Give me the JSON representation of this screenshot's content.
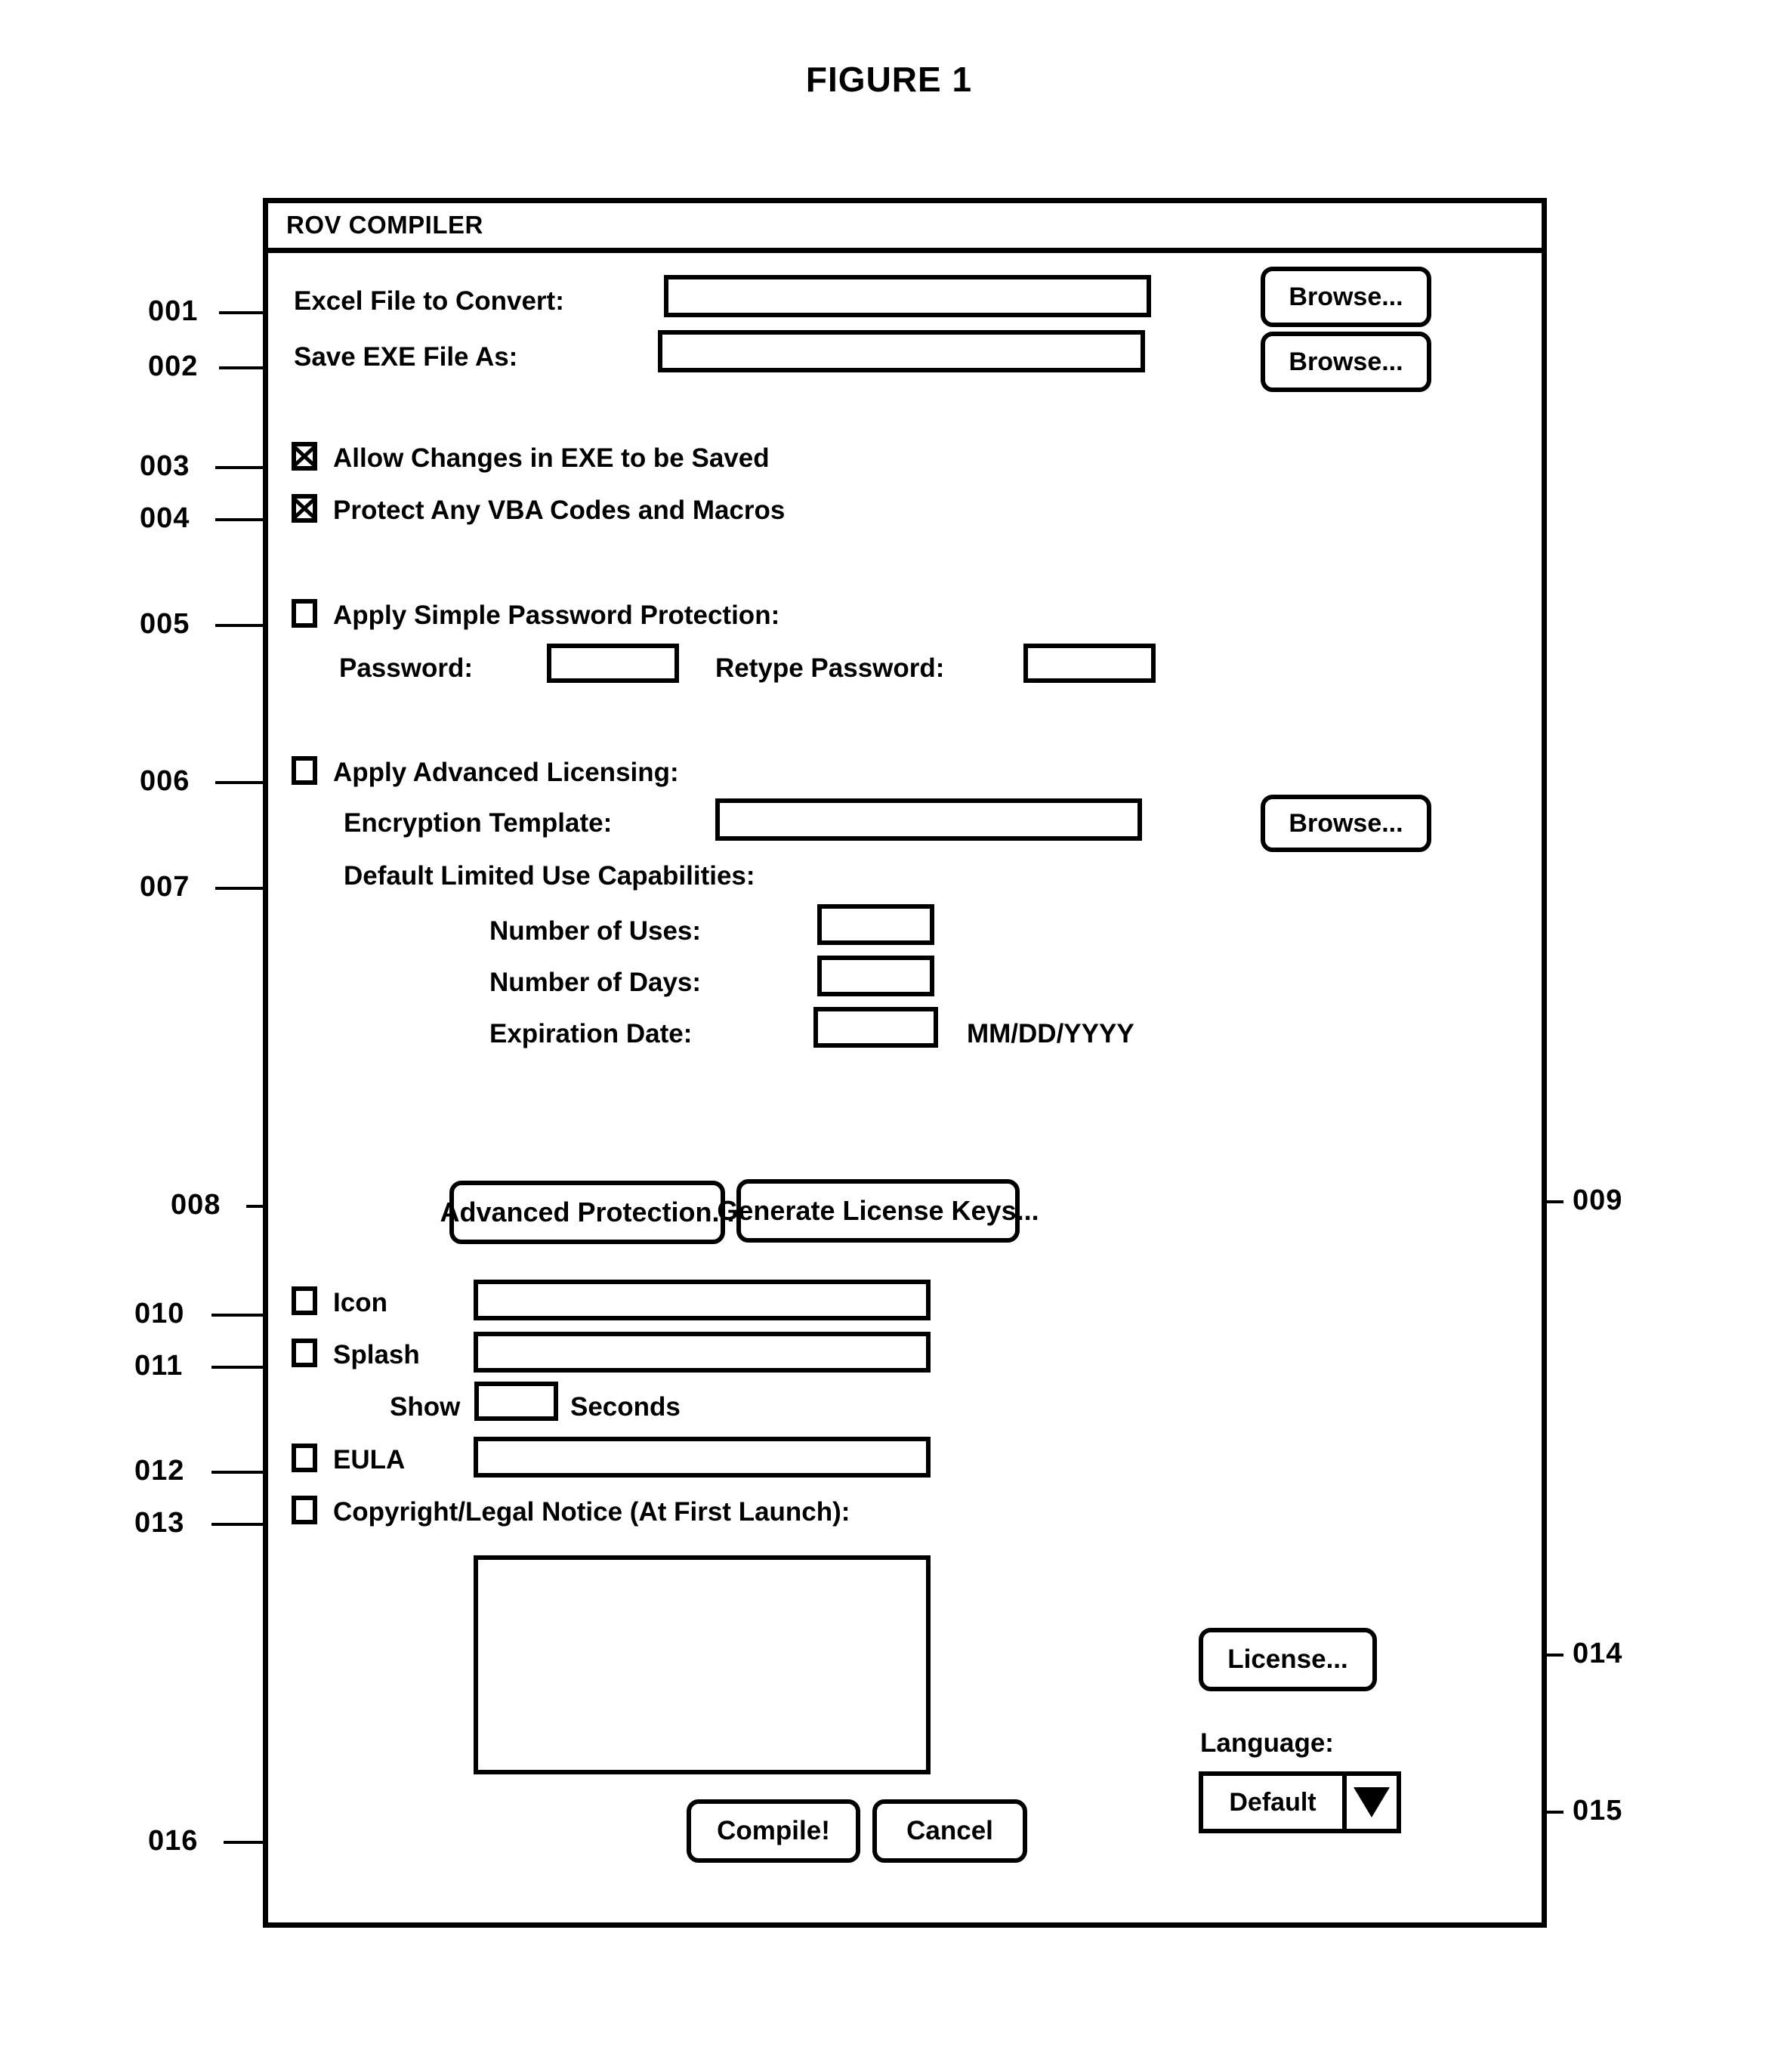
{
  "figure": {
    "title": "FIGURE 1"
  },
  "window": {
    "title": "ROV COMPILER"
  },
  "fields": {
    "excel_file_label": "Excel File to Convert:",
    "excel_file_value": "",
    "save_exe_label": "Save EXE File As:",
    "save_exe_value": "",
    "browse_label": "Browse...",
    "allow_changes_label": "Allow Changes in EXE to be Saved",
    "protect_vba_label": "Protect Any VBA Codes and Macros",
    "simple_password_label": "Apply Simple Password Protection:",
    "password_label": "Password:",
    "password_value": "",
    "retype_password_label": "Retype Password:",
    "retype_password_value": "",
    "advanced_licensing_label": "Apply Advanced Licensing:",
    "encryption_template_label": "Encryption Template:",
    "encryption_template_value": "",
    "default_limited_use_label": "Default Limited Use Capabilities:",
    "number_of_uses_label": "Number of Uses:",
    "number_of_uses_value": "",
    "number_of_days_label": "Number of Days:",
    "number_of_days_value": "",
    "expiration_date_label": "Expiration Date:",
    "expiration_date_value": "",
    "date_format_hint": "MM/DD/YYYY",
    "advanced_protection_label": "Advanced Protection...",
    "generate_license_keys_label": "Generate License Keys...",
    "icon_label": "Icon",
    "icon_value": "",
    "splash_label": "Splash",
    "splash_value": "",
    "show_label": "Show",
    "show_seconds_value": "",
    "seconds_label": "Seconds",
    "eula_label": "EULA",
    "eula_value": "",
    "copyright_notice_label": "Copyright/Legal Notice (At First Launch):",
    "copyright_notice_value": "",
    "license_label": "License...",
    "language_label": "Language:",
    "language_value": "Default",
    "compile_label": "Compile!",
    "cancel_label": "Cancel"
  },
  "checkboxes": {
    "allow_changes_checked": true,
    "protect_vba_checked": true,
    "simple_password_checked": false,
    "advanced_licensing_checked": false,
    "icon_checked": false,
    "splash_checked": false,
    "eula_checked": false,
    "copyright_checked": false
  },
  "reference_numbers": {
    "r001": "001",
    "r002": "002",
    "r003": "003",
    "r004": "004",
    "r005": "005",
    "r006": "006",
    "r007": "007",
    "r008": "008",
    "r009": "009",
    "r010": "010",
    "r011": "011",
    "r012": "012",
    "r013": "013",
    "r014": "014",
    "r015": "015",
    "r016": "016"
  },
  "colors": {
    "ink": "#000000",
    "paper": "#ffffff"
  }
}
